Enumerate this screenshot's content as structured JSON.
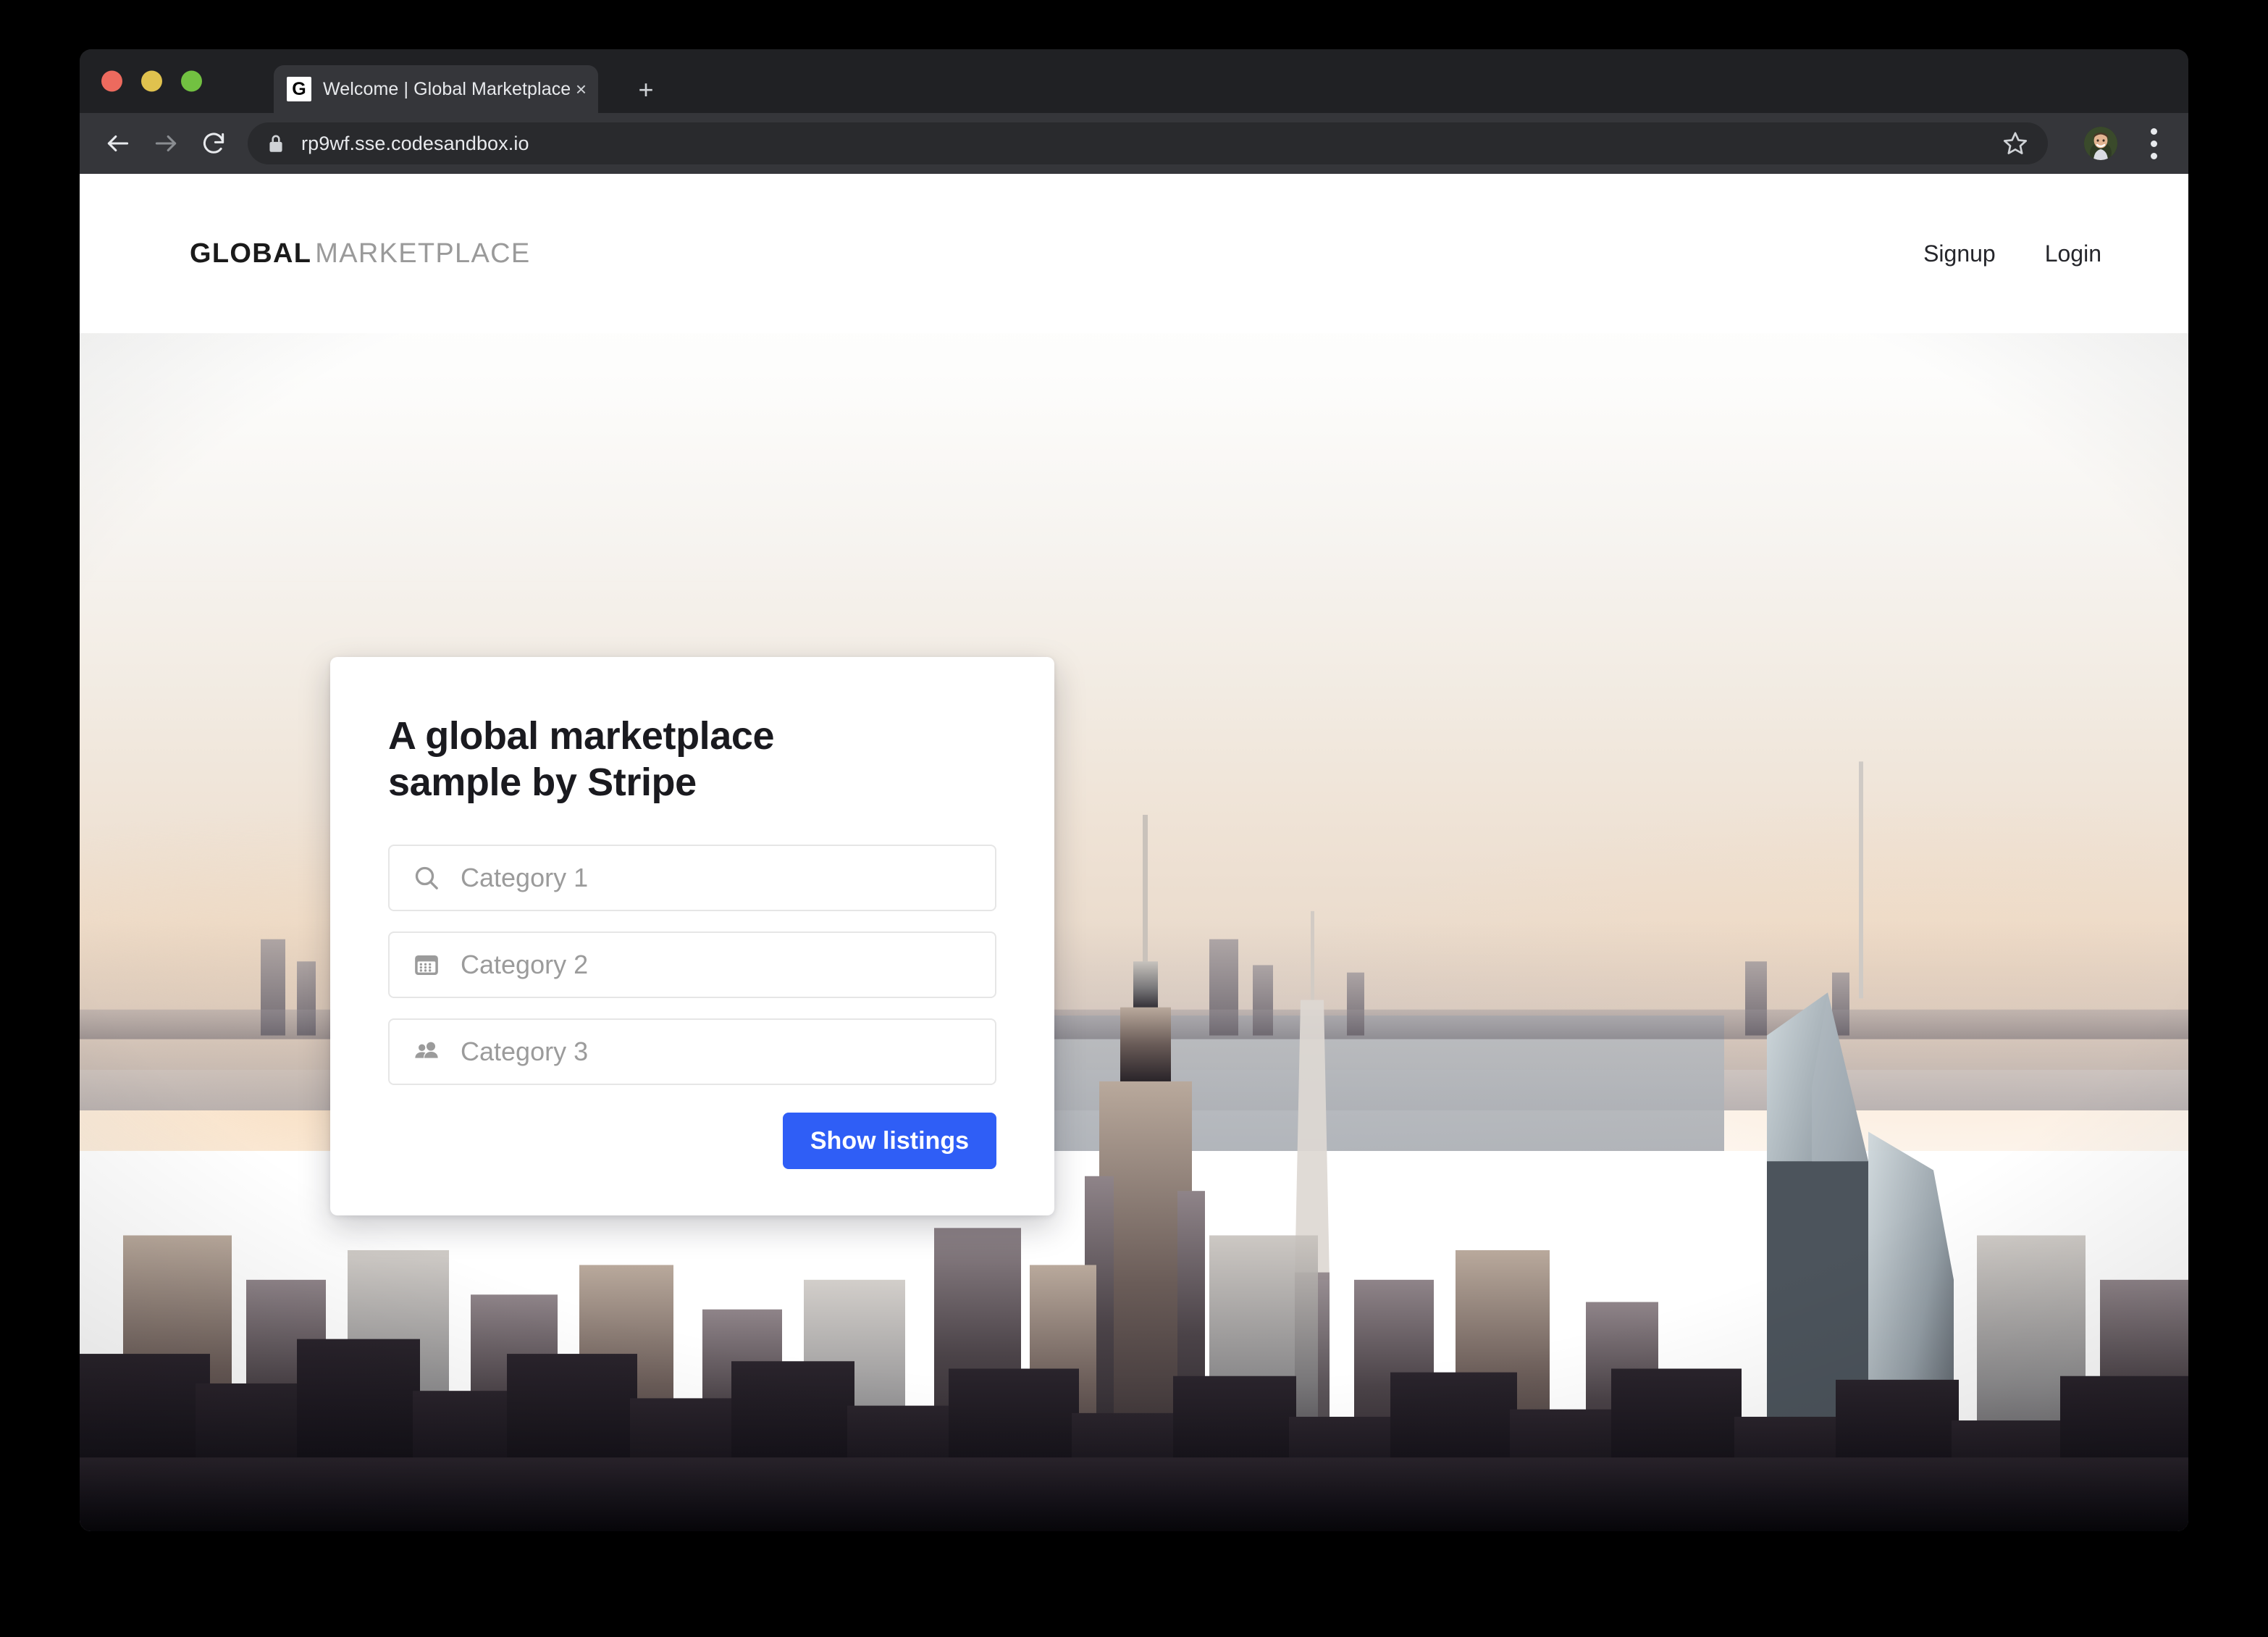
{
  "browser": {
    "tab": {
      "favicon_letter": "G",
      "title": "Welcome | Global Marketplace",
      "close_label": "×",
      "close_icon": "close-icon"
    },
    "new_tab_label": "+",
    "toolbar": {
      "back_icon": "back-arrow-icon",
      "forward_icon": "forward-arrow-icon",
      "reload_icon": "reload-icon",
      "lock_icon": "lock-icon",
      "url": "rp9wf.sse.codesandbox.io",
      "bookmark_icon": "bookmark-star-icon",
      "avatar_icon": "profile-avatar",
      "menu_icon": "three-dot-menu-icon"
    },
    "traffic_lights": {
      "close": "#ed6a5e",
      "minimize": "#e0c24e",
      "zoom": "#72c141"
    }
  },
  "site": {
    "logo": {
      "bold": "GLOBAL",
      "light": "MARKETPLACE"
    },
    "nav": [
      {
        "label": "Signup",
        "name": "nav-link-signup"
      },
      {
        "label": "Login",
        "name": "nav-link-login"
      }
    ]
  },
  "hero": {
    "image_description": "New York City skyline at dusk seen from above, warm hazy sky over Manhattan"
  },
  "card": {
    "heading": "A global marketplace sample by Stripe",
    "fields": [
      {
        "icon": "search-icon",
        "placeholder": "Category 1",
        "name": "category-1-input"
      },
      {
        "icon": "calendar-icon",
        "placeholder": "Category 2",
        "name": "category-2-input"
      },
      {
        "icon": "people-icon",
        "placeholder": "Category 3",
        "name": "category-3-input"
      }
    ],
    "submit_label": "Show listings",
    "accent_color": "#2f5ef6"
  }
}
